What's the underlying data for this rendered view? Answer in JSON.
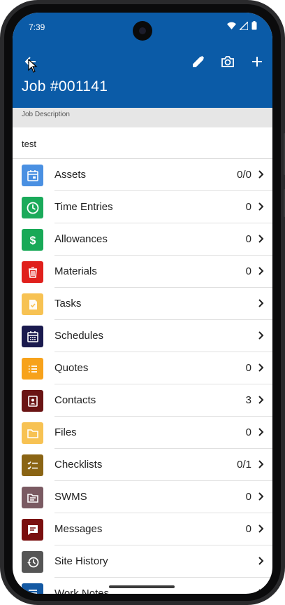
{
  "status_bar": {
    "time": "7:39"
  },
  "header": {
    "title": "Job #001141"
  },
  "description": {
    "label": "Job Description",
    "value": "test"
  },
  "colors": {
    "appbar": "#0b5ba7"
  },
  "items": [
    {
      "label": "Assets",
      "count": "0/0",
      "icon": "calendar-icon",
      "color": "#4a90e2"
    },
    {
      "label": "Time Entries",
      "count": "0",
      "icon": "clock-icon",
      "color": "#1aaa5a"
    },
    {
      "label": "Allowances",
      "count": "0",
      "icon": "dollar-icon",
      "color": "#18a957"
    },
    {
      "label": "Materials",
      "count": "0",
      "icon": "trash-icon",
      "color": "#e0201c"
    },
    {
      "label": "Tasks",
      "count": "",
      "icon": "task-icon",
      "color": "#f7c253"
    },
    {
      "label": "Schedules",
      "count": "",
      "icon": "calendar-grid-icon",
      "color": "#1a1a4e"
    },
    {
      "label": "Quotes",
      "count": "0",
      "icon": "list-icon",
      "color": "#f7a21b"
    },
    {
      "label": "Contacts",
      "count": "3",
      "icon": "contact-icon",
      "color": "#6a1414"
    },
    {
      "label": "Files",
      "count": "0",
      "icon": "folder-icon",
      "color": "#f7c253"
    },
    {
      "label": "Checklists",
      "count": "0/1",
      "icon": "checklist-icon",
      "color": "#8a6414"
    },
    {
      "label": "SWMS",
      "count": "0",
      "icon": "file-icon",
      "color": "#7a5a62"
    },
    {
      "label": "Messages",
      "count": "0",
      "icon": "message-icon",
      "color": "#7a0f0f"
    },
    {
      "label": "Site History",
      "count": "",
      "icon": "history-icon",
      "color": "#555555"
    },
    {
      "label": "Work Notes",
      "count": "",
      "icon": "note-icon",
      "color": "#1459a3"
    }
  ]
}
